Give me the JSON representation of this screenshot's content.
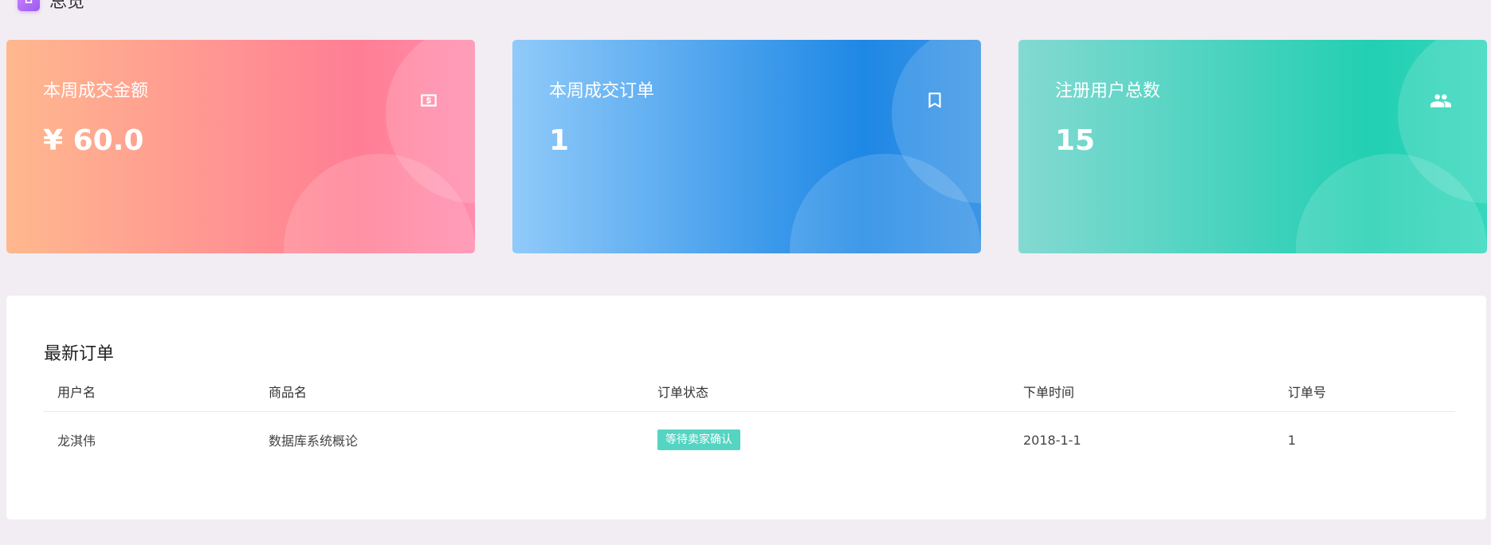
{
  "header": {
    "title": "总览"
  },
  "stats": [
    {
      "label": "本周成交金额",
      "value": "¥ 60.0",
      "icon": "money-icon",
      "color_from": "#ffb88e",
      "color_to": "#ff7e94"
    },
    {
      "label": "本周成交订单",
      "value": "1",
      "icon": "bookmark-icon",
      "color_from": "#90caf9",
      "color_to": "#1e88e5"
    },
    {
      "label": "注册用户总数",
      "value": "15",
      "icon": "people-icon",
      "color_from": "#84d9d2",
      "color_to": "#22cfb2"
    }
  ],
  "orders": {
    "title": "最新订单",
    "columns": [
      "用户名",
      "商品名",
      "订单状态",
      "下单时间",
      "订单号"
    ],
    "rows": [
      {
        "user": "龙淇伟",
        "goods": "数据库系统概论",
        "status": "等待卖家确认",
        "time": "2018-1-1",
        "order_no": "1"
      }
    ],
    "status_color": "#55d4c2"
  }
}
